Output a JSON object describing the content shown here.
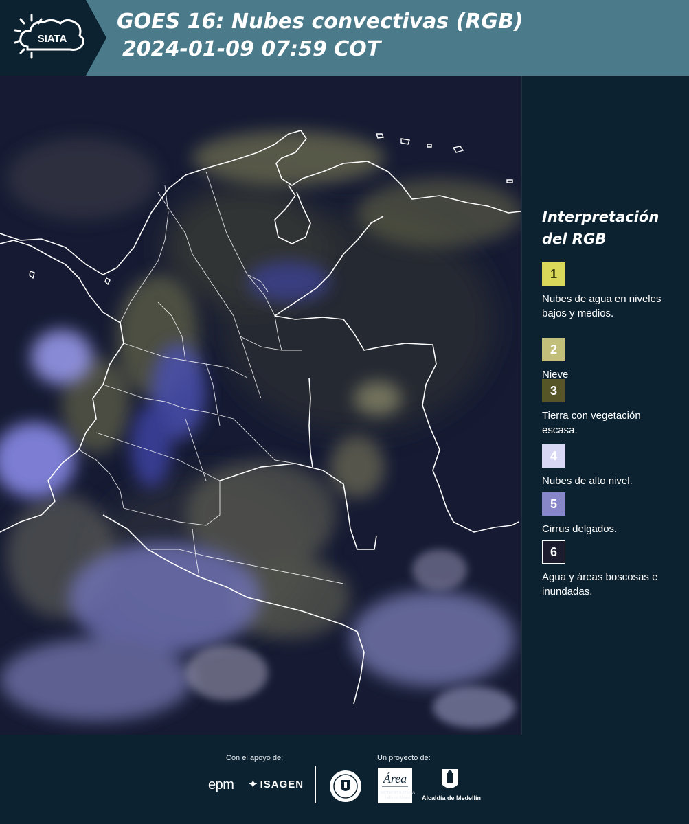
{
  "header": {
    "logo_text": "SIATA",
    "title_line1": "GOES 16: Nubes convectivas (RGB)",
    "title_line2": "2024-01-09 07:59 COT",
    "background_color": "#4b7a8a"
  },
  "map": {
    "type": "satellite-rgb-composite",
    "product": "Nubes convectivas (RGB)",
    "satellite": "GOES 16",
    "region_shown": "Colombia",
    "background_color": "#141a30",
    "border_color": "#ffffff"
  },
  "legend": {
    "title": "Interpretación del RGB",
    "items": [
      {
        "number": "1",
        "label": "Nubes de agua en niveles bajos y medios.",
        "color": "#d9d85a",
        "text_color": "#3a3a10"
      },
      {
        "number": "2",
        "label": "Nieve",
        "color": "#c2bf7a",
        "text_color": "#ffffff"
      },
      {
        "number": "3",
        "label": "Tierra con vegetación escasa.",
        "color": "#555528",
        "text_color": "#ffffff"
      },
      {
        "number": "4",
        "label": "Nubes de alto nivel.",
        "color": "#d8d8f4",
        "text_color": "#ffffff"
      },
      {
        "number": "5",
        "label": "Cirrus delgados.",
        "color": "#8686c9",
        "text_color": "#ffffff"
      },
      {
        "number": "6",
        "label": "Agua y áreas boscosas e inundadas.",
        "color": "#1c1c2e",
        "text_color": "#ffffff"
      }
    ]
  },
  "footer": {
    "support_caption": "Con el apoyo de:",
    "project_caption": "Un proyecto de:",
    "epm_logo": "epm",
    "isagen_logo": "ISAGEN",
    "area_text": "METROPOLITANA Valle de Aburrá",
    "alcaldia_text": "Alcaldía de Medellín"
  }
}
